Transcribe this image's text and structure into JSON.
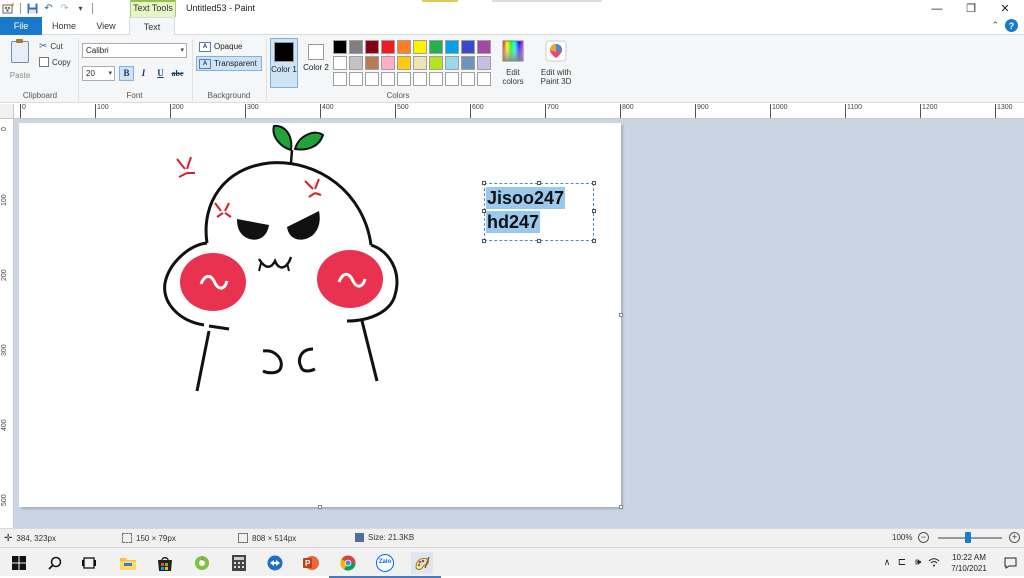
{
  "window": {
    "title": "Untitled53 - Paint",
    "context_tab": "Text Tools",
    "min_glyph": "—",
    "max_glyph": "❐",
    "close_glyph": "✕"
  },
  "tabs": {
    "file": "File",
    "home": "Home",
    "view": "View",
    "text": "Text"
  },
  "ribbon": {
    "clipboard": {
      "label": "Clipboard",
      "paste": "Paste",
      "cut": "Cut",
      "copy": "Copy"
    },
    "font": {
      "label": "Font",
      "family": "Calibri",
      "size": "20",
      "bold": "B",
      "italic": "I",
      "underline": "U",
      "strike": "abc"
    },
    "background": {
      "label": "Background",
      "opaque": "Opaque",
      "transparent": "Transparent"
    },
    "colors": {
      "label": "Colors",
      "color1": "Color 1",
      "color2": "Color 2",
      "color1_value": "#000000",
      "color2_value": "#ffffff",
      "edit_colors": "Edit colors",
      "edit_3d": "Edit with Paint 3D",
      "palette_row1": [
        "#000000",
        "#7f7f7f",
        "#880015",
        "#ed1c24",
        "#ff7f27",
        "#fff200",
        "#22b14c",
        "#00a2e8",
        "#3f48cc",
        "#a349a4"
      ],
      "palette_row2": [
        "#ffffff",
        "#c3c3c3",
        "#b97a57",
        "#ffaec9",
        "#ffc90e",
        "#efe4b0",
        "#b5e61d",
        "#99d9ea",
        "#7092be",
        "#c8bfe7"
      ],
      "palette_row3": [
        "#ffffff",
        "#ffffff",
        "#ffffff",
        "#ffffff",
        "#ffffff",
        "#ffffff",
        "#ffffff",
        "#ffffff",
        "#ffffff",
        "#ffffff"
      ]
    }
  },
  "ruler": {
    "h_ticks": [
      "0",
      "100",
      "200",
      "300",
      "400",
      "500",
      "600",
      "700",
      "800",
      "900",
      "1000",
      "1100",
      "1200",
      "1300"
    ],
    "v_ticks": [
      "0",
      "100",
      "200",
      "300",
      "400",
      "500"
    ]
  },
  "canvas": {
    "text_lines": [
      "Jisoo247",
      "hd247"
    ]
  },
  "status": {
    "cursor": "384, 323px",
    "selection": "150 × 79px",
    "canvas_size": "808 × 514px",
    "file_size": "Size: 21.3KB",
    "zoom": "100%"
  },
  "taskbar": {
    "time": "10:22 AM",
    "date": "7/10/2021",
    "zalo": "Zalo"
  }
}
